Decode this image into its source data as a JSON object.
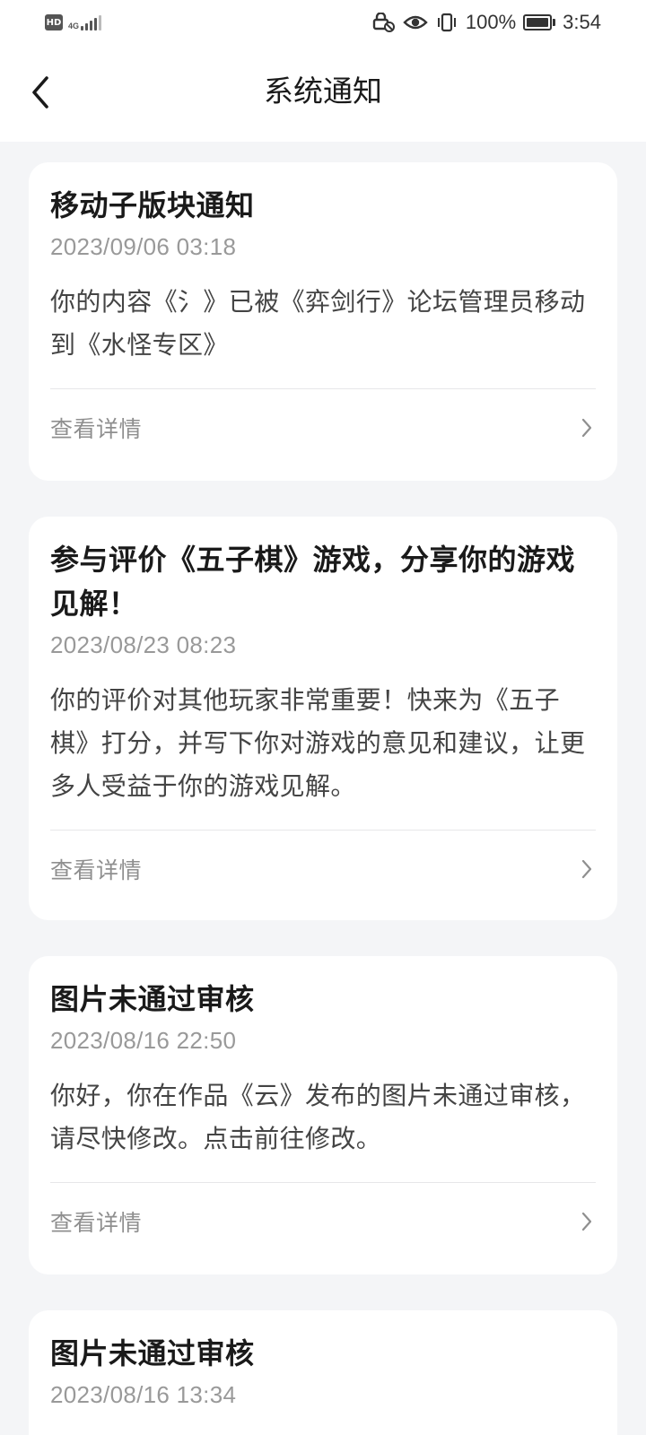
{
  "status_bar": {
    "hd_label": "HD",
    "network_label": "4G",
    "battery": "100%",
    "battery_level": 1.0,
    "time": "3:54"
  },
  "header": {
    "title": "系统通知"
  },
  "notifications": [
    {
      "title": "移动子版块通知",
      "time": "2023/09/06 03:18",
      "body": "你的内容《氵》已被《弈剑行》论坛管理员移动到《水怪专区》",
      "link_label": "查看详情"
    },
    {
      "title": "参与评价《五子棋》游戏，分享你的游戏见解！",
      "time": "2023/08/23 08:23",
      "body": "你的评价对其他玩家非常重要！快来为《五子棋》打分，并写下你对游戏的意见和建议，让更多人受益于你的游戏见解。",
      "link_label": "查看详情"
    },
    {
      "title": "图片未通过审核",
      "time": "2023/08/16 22:50",
      "body": "你好，你在作品《云》发布的图片未通过审核，请尽快修改。点击前往修改。",
      "link_label": "查看详情"
    },
    {
      "title": "图片未通过审核",
      "time": "2023/08/16 13:34",
      "body": "",
      "link_label": ""
    }
  ],
  "colors": {
    "page_background": "#f4f5f7",
    "card_background": "#ffffff",
    "title_text": "#1a1a1a",
    "muted_text": "#999999"
  }
}
